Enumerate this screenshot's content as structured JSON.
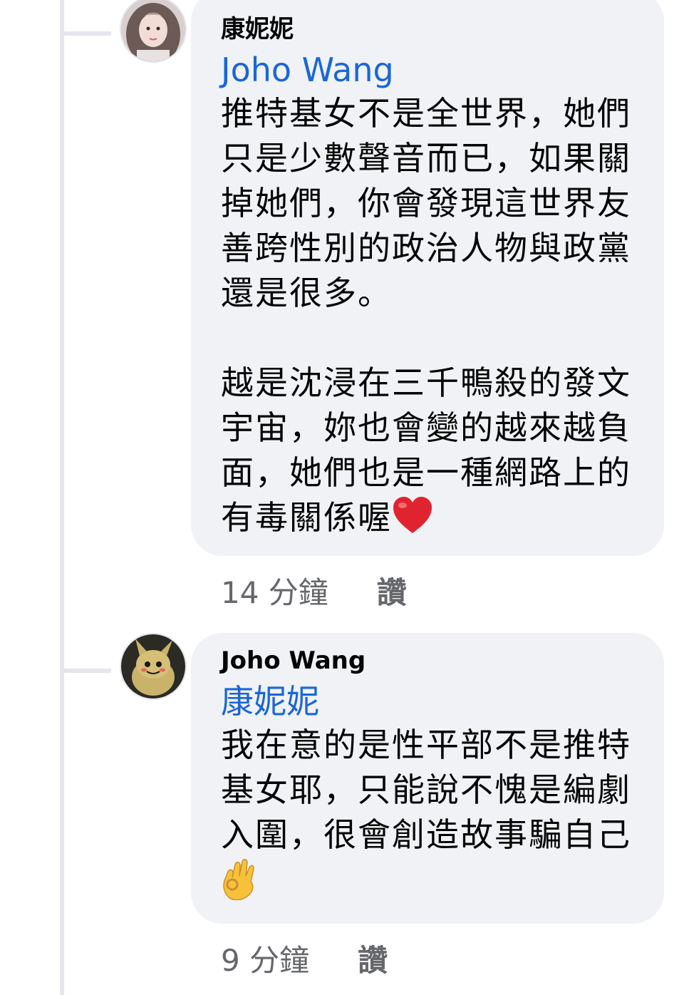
{
  "comments": [
    {
      "author": "康妮妮",
      "mention": "Joho Wang",
      "text": "推特基女不是全世界，她們只是少數聲音而已，如果關掉她們，你會發現這世界友善跨性別的政治人物與政黨還是很多。\n\n越是沈浸在三千鴨殺的發文宇宙，妳也會變的越來越負面，她們也是一種網路上的有毒關係喔",
      "emoji": "heart-emoji",
      "time": "14 分鐘",
      "like_label": "讚"
    },
    {
      "author": "Joho Wang",
      "mention": "康妮妮",
      "text": "我在意的是性平部不是推特基女耶，只能說不愧是編劇入圍，很會創造故事騙自己",
      "emoji": "ok-hand-emoji",
      "time": "9 分鐘",
      "like_label": "讚"
    }
  ],
  "colors": {
    "mention": "#1a66d8",
    "bubble": "#f0f2f5",
    "meta": "#65676b",
    "heart": "#e0242f",
    "ok_hand": "#f7c23a"
  }
}
